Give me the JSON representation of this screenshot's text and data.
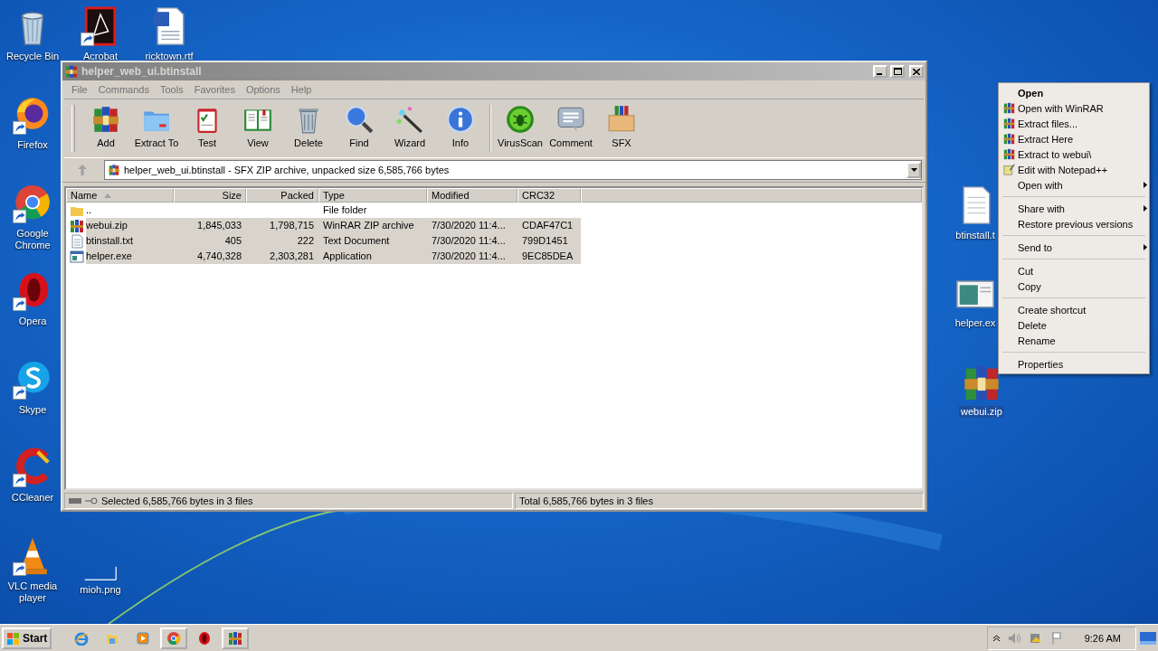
{
  "desktop_icons": [
    {
      "label": "Recycle Bin",
      "selected": false
    },
    {
      "label": "Acrobat",
      "selected": false
    },
    {
      "label": "ricktown.rtf",
      "selected": false
    },
    {
      "label": "Firefox",
      "selected": false
    },
    {
      "label": "Google Chrome",
      "selected": false
    },
    {
      "label": "Opera",
      "selected": false
    },
    {
      "label": "Skype",
      "selected": false
    },
    {
      "label": "CCleaner",
      "selected": false
    },
    {
      "label": "VLC media player",
      "selected": false
    },
    {
      "label": "mioh.png",
      "selected": false
    },
    {
      "label": "btinstall.t",
      "selected": false
    },
    {
      "label": "helper.ex",
      "selected": false
    },
    {
      "label": "webui.zip",
      "selected": true
    }
  ],
  "window": {
    "title": "helper_web_ui.btinstall",
    "menu": [
      "File",
      "Commands",
      "Tools",
      "Favorites",
      "Options",
      "Help"
    ],
    "toolbar": [
      "Add",
      "Extract To",
      "Test",
      "View",
      "Delete",
      "Find",
      "Wizard",
      "Info",
      "VirusScan",
      "Comment",
      "SFX"
    ],
    "address": "helper_web_ui.btinstall - SFX ZIP archive, unpacked size 6,585,766 bytes",
    "columns": [
      {
        "label": "Name",
        "sorted": true
      },
      {
        "label": "Size",
        "sorted": false
      },
      {
        "label": "Packed",
        "sorted": false
      },
      {
        "label": "Type",
        "sorted": false
      },
      {
        "label": "Modified",
        "sorted": false
      },
      {
        "label": "CRC32",
        "sorted": false
      }
    ],
    "rows": [
      {
        "kind": "folder",
        "name": "..",
        "size": "",
        "packed": "",
        "type": "File folder",
        "modified": "",
        "crc": "",
        "selected": false
      },
      {
        "kind": "archive",
        "name": "webui.zip",
        "size": "1,845,033",
        "packed": "1,798,715",
        "type": "WinRAR ZIP archive",
        "modified": "7/30/2020 11:4...",
        "crc": "CDAF47C1",
        "selected": true
      },
      {
        "kind": "text",
        "name": "btinstall.txt",
        "size": "405",
        "packed": "222",
        "type": "Text Document",
        "modified": "7/30/2020 11:4...",
        "crc": "799D1451",
        "selected": true
      },
      {
        "kind": "program",
        "name": "helper.exe",
        "size": "4,740,328",
        "packed": "2,303,281",
        "type": "Application",
        "modified": "7/30/2020 11:4...",
        "crc": "9EC85DEA",
        "selected": true
      }
    ],
    "status_left": "Selected 6,585,766 bytes in 3 files",
    "status_right": "Total 6,585,766 bytes in 3 files"
  },
  "context_menu": [
    {
      "kind": "item",
      "label": "Open",
      "default": true,
      "submenu": false
    },
    {
      "kind": "item",
      "label": "Open with WinRAR",
      "default": false,
      "submenu": false
    },
    {
      "kind": "item",
      "label": "Extract files...",
      "default": false,
      "submenu": false
    },
    {
      "kind": "item",
      "label": "Extract Here",
      "default": false,
      "submenu": false
    },
    {
      "kind": "item",
      "label": "Extract to webui\\",
      "default": false,
      "submenu": false
    },
    {
      "kind": "item",
      "label": "Edit with Notepad++",
      "default": false,
      "submenu": false
    },
    {
      "kind": "item",
      "label": "Open with",
      "default": false,
      "submenu": true
    },
    {
      "kind": "separator"
    },
    {
      "kind": "item",
      "label": "Share with",
      "default": false,
      "submenu": true
    },
    {
      "kind": "item",
      "label": "Restore previous versions",
      "default": false,
      "submenu": false
    },
    {
      "kind": "separator"
    },
    {
      "kind": "item",
      "label": "Send to",
      "default": false,
      "submenu": true
    },
    {
      "kind": "separator"
    },
    {
      "kind": "item",
      "label": "Cut",
      "default": false,
      "submenu": false
    },
    {
      "kind": "item",
      "label": "Copy",
      "default": false,
      "submenu": false
    },
    {
      "kind": "separator"
    },
    {
      "kind": "item",
      "label": "Create shortcut",
      "default": false,
      "submenu": false
    },
    {
      "kind": "item",
      "label": "Delete",
      "default": false,
      "submenu": false
    },
    {
      "kind": "item",
      "label": "Rename",
      "default": false,
      "submenu": false
    },
    {
      "kind": "separator"
    },
    {
      "kind": "item",
      "label": "Properties",
      "default": false,
      "submenu": false
    }
  ],
  "taskbar": {
    "start": "Start",
    "buttons": [
      {
        "open": false
      },
      {
        "open": false
      },
      {
        "open": false
      },
      {
        "open": true
      },
      {
        "open": false
      },
      {
        "open": true
      }
    ],
    "clock": "9:26 AM"
  }
}
